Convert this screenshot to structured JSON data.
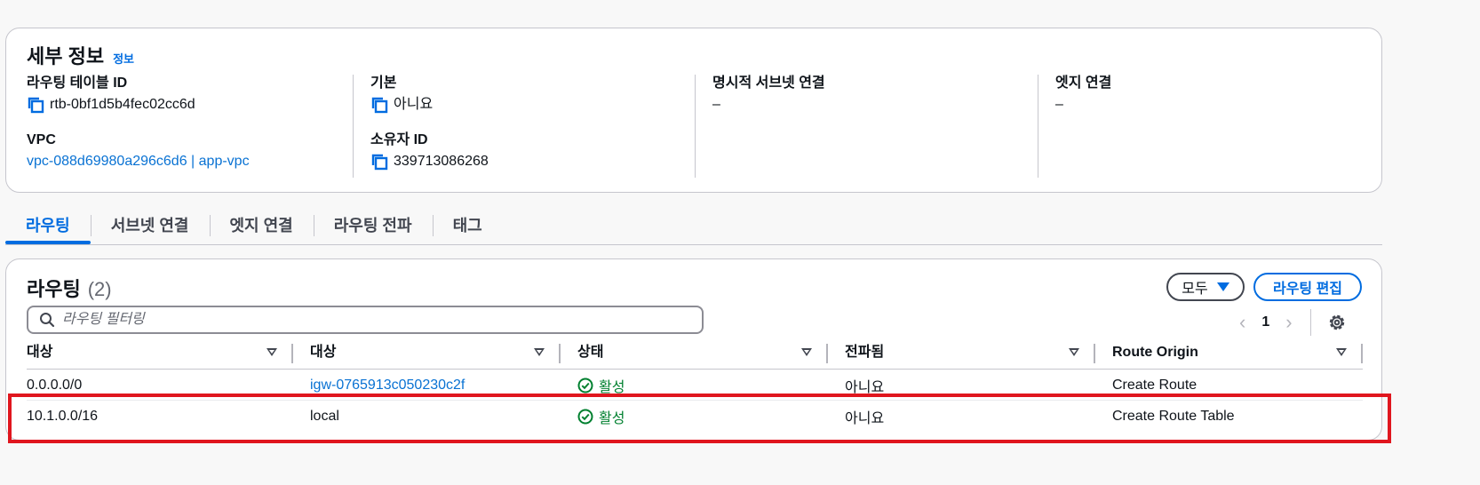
{
  "details": {
    "title": "세부 정보",
    "info_link": "정보",
    "route_table_id_label": "라우팅 테이블 ID",
    "route_table_id": "rtb-0bf1d5b4fec02cc6d",
    "vpc_label": "VPC",
    "vpc_value": "vpc-088d69980a296c6d6 | app-vpc",
    "main_label": "기본",
    "main_value": "아니요",
    "owner_id_label": "소유자 ID",
    "owner_id": "339713086268",
    "explicit_subnet_label": "명시적 서브넷 연결",
    "explicit_subnet_value": "–",
    "edge_assoc_label": "엣지 연결",
    "edge_assoc_value": "–"
  },
  "tabs": [
    {
      "label": "라우팅",
      "active": true
    },
    {
      "label": "서브넷 연결",
      "active": false
    },
    {
      "label": "엣지 연결",
      "active": false
    },
    {
      "label": "라우팅 전파",
      "active": false
    },
    {
      "label": "태그",
      "active": false
    }
  ],
  "routes": {
    "title": "라우팅",
    "count": "(2)",
    "filter_button": "모두",
    "edit_button": "라우팅 편집",
    "search_placeholder": "라우팅 필터링",
    "page": "1",
    "columns": [
      "대상",
      "대상",
      "상태",
      "전파됨",
      "Route Origin"
    ],
    "rows": [
      {
        "destination": "0.0.0.0/0",
        "target": "igw-0765913c050230c2f",
        "target_link": true,
        "status": "활성",
        "propagated": "아니요",
        "origin": "Create Route"
      },
      {
        "destination": "10.1.0.0/16",
        "target": "local",
        "target_link": false,
        "status": "활성",
        "propagated": "아니요",
        "origin": "Create Route Table"
      }
    ]
  },
  "colors": {
    "accent": "#006ce0",
    "link": "#0972d3",
    "success": "#00802f",
    "highlight": "#e0161e"
  },
  "icons": {
    "copy": "copy-icon",
    "search": "search-icon",
    "status": "check-circle-icon",
    "settings": "gear-icon"
  }
}
